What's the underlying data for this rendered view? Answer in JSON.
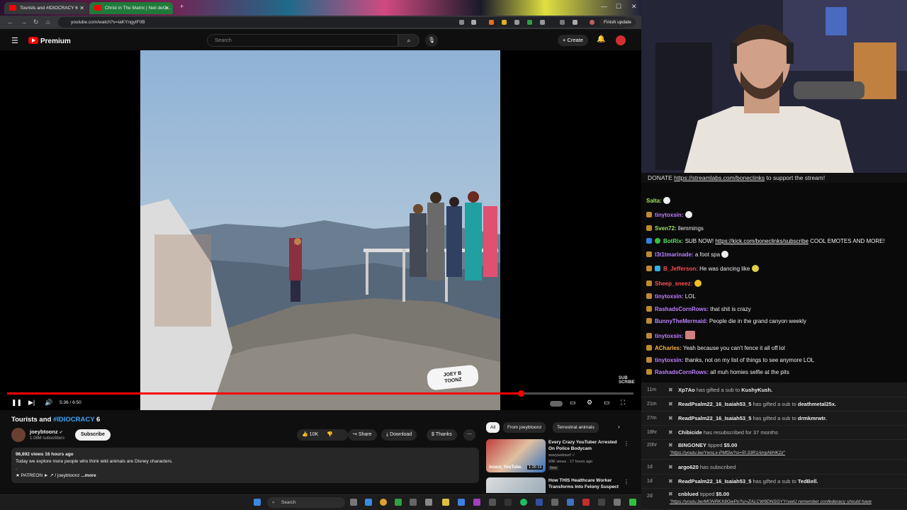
{
  "browser": {
    "tabs": [
      {
        "label": "Tourists and #IDIOCRACY 6"
      },
      {
        "label": "Christ in The Matrix | Neil deGr..."
      }
    ],
    "url": "youtube.com/watch?v=iaKYngyIF0B",
    "finish_update": "Finish update"
  },
  "youtube": {
    "logo": "Premium",
    "search_placeholder": "Search",
    "create_label": "Create"
  },
  "player": {
    "time": "5:36 / 6:50",
    "progress": 0.82,
    "watermark_line1": "JOEY B",
    "watermark_line2": "TOONZ"
  },
  "video": {
    "title_prefix": "Tourists and ",
    "title_tag": "#IDIOCRACY",
    "title_suffix": " 6",
    "channel": "joeybtoonz",
    "subscribers": "1.08M subscribers",
    "subscribe_label": "Subscribe",
    "likes": "10K",
    "share": "Share",
    "download": "Download",
    "thanks": "Thanks",
    "description_meta": "96,692 views  16 hours ago",
    "description_text": "Today we explore more people who think wild animals are Disney characters.",
    "description_dot": ".",
    "description_patreon": "★ PATREON ► ↗ / joeybtoonz",
    "more": "...more"
  },
  "recs": {
    "chips": [
      "All",
      "From joeybtoonz",
      "Terrestrial animals"
    ],
    "items": [
      {
        "title": "Every Crazy YouTuber Arrested On Police Bodycam",
        "channel": "wavywebsurf ✓",
        "views": "93K views · 17 hours ago",
        "badge": "New",
        "duration": "1:26:19",
        "thumb_text": "Incest, YouTube."
      },
      {
        "title": "How THIS Healthcare Worker Transforms Into Felony Suspect",
        "channel": "",
        "views": "",
        "badge": "",
        "duration": "",
        "thumb_text": ""
      }
    ]
  },
  "stream": {
    "donate_prefix": "DONATE ",
    "donate_link": "https://streamlabs.com/boneclinks",
    "donate_suffix": " to support the stream!",
    "chat": [
      {
        "user": "Salta:",
        "text": "",
        "color": "#a0e060",
        "emote": true
      },
      {
        "user": "tinytoxsin:",
        "text": "",
        "color": "#c080ff",
        "emote": true
      },
      {
        "user": "Sven72:",
        "text": "llemmings",
        "color": "#a0e060",
        "emote": false
      },
      {
        "user": "BotRix:",
        "text": "SUB NOW! ",
        "link": "https://kick.com/boneclinks/subscribe",
        "after": " COOL EMOTES AND MORE!",
        "color": "#60e060",
        "emote": false
      },
      {
        "user": "l3t1tmarinade:",
        "text": "a foot spa",
        "color": "#c080ff",
        "emote": true
      },
      {
        "user": "B_Jefferson:",
        "text": "He was dancing like",
        "color": "#ff5050",
        "emote": true
      },
      {
        "user": "Sheep_sneez:",
        "text": "",
        "color": "#ff5050",
        "emote": true
      },
      {
        "user": "tinytoxsin:",
        "text": "LOL",
        "color": "#c080ff",
        "emote": false
      },
      {
        "user": "RashadsCornRows:",
        "text": "that shit is crazy",
        "color": "#c080ff",
        "emote": false
      },
      {
        "user": "BunnyTheMermaid:",
        "text": "People die in the grand canyon weekly",
        "color": "#c080ff",
        "emote": false
      },
      {
        "user": "tinytoxsin:",
        "text": "",
        "color": "#c080ff",
        "emote": true
      },
      {
        "user": "ACharles:",
        "text": "Yeah because you can't fence it all off lol",
        "color": "#ffb040",
        "emote": false
      },
      {
        "user": "tinytoxsin:",
        "text": "thanks, not on my list of things to see anymore LOL",
        "color": "#c080ff",
        "emote": false
      },
      {
        "user": "RashadsCornRows:",
        "text": "all muh homies selfie at the pits",
        "color": "#c080ff",
        "emote": false
      }
    ],
    "events": [
      {
        "time": "11m",
        "user": "Xp7Ao",
        "text": " has gifted a sub to ",
        "target": "KushyKush.",
        "line2": ""
      },
      {
        "time": "21m",
        "user": "ReadPsalm22_16_Isaiah53_5",
        "text": " has gifted a sub to ",
        "target": "deathmetal25x.",
        "line2": ""
      },
      {
        "time": "27m",
        "user": "ReadPsalm22_16_Isaiah53_5",
        "text": " has gifted a sub to ",
        "target": "drmkmrwtr.",
        "line2": ""
      },
      {
        "time": "18hr",
        "user": "Chibicide",
        "text": " has resubscribed for 37 months",
        "target": "",
        "line2": ""
      },
      {
        "time": "20hr",
        "user": "BINGONEY",
        "text": " tipped ",
        "target": "$5.00",
        "line2": "\"https://youtu.be/YwsLx-PMf2w?si=5f-33R1AmpNIHK2z\""
      },
      {
        "time": "1d",
        "user": "argo620",
        "text": " has subscribed",
        "target": "",
        "line2": ""
      },
      {
        "time": "1d",
        "user": "ReadPsalm22_16_Isaiah53_5",
        "text": " has gifted a sub to ",
        "target": "TedBell.",
        "line2": ""
      },
      {
        "time": "2d",
        "user": "cnblued",
        "text": " tipped ",
        "target": "$5.00",
        "line2": "\"https://youtu.be/MONRKX8GwPo?si=ZALCW9DNSGYYruwU remember confederacy should have"
      }
    ]
  },
  "taskbar": {
    "search_placeholder": "Search"
  },
  "colors": {
    "accent": "#ff0000",
    "link": "#3ea6ff",
    "bg": "#0f0f0f"
  }
}
